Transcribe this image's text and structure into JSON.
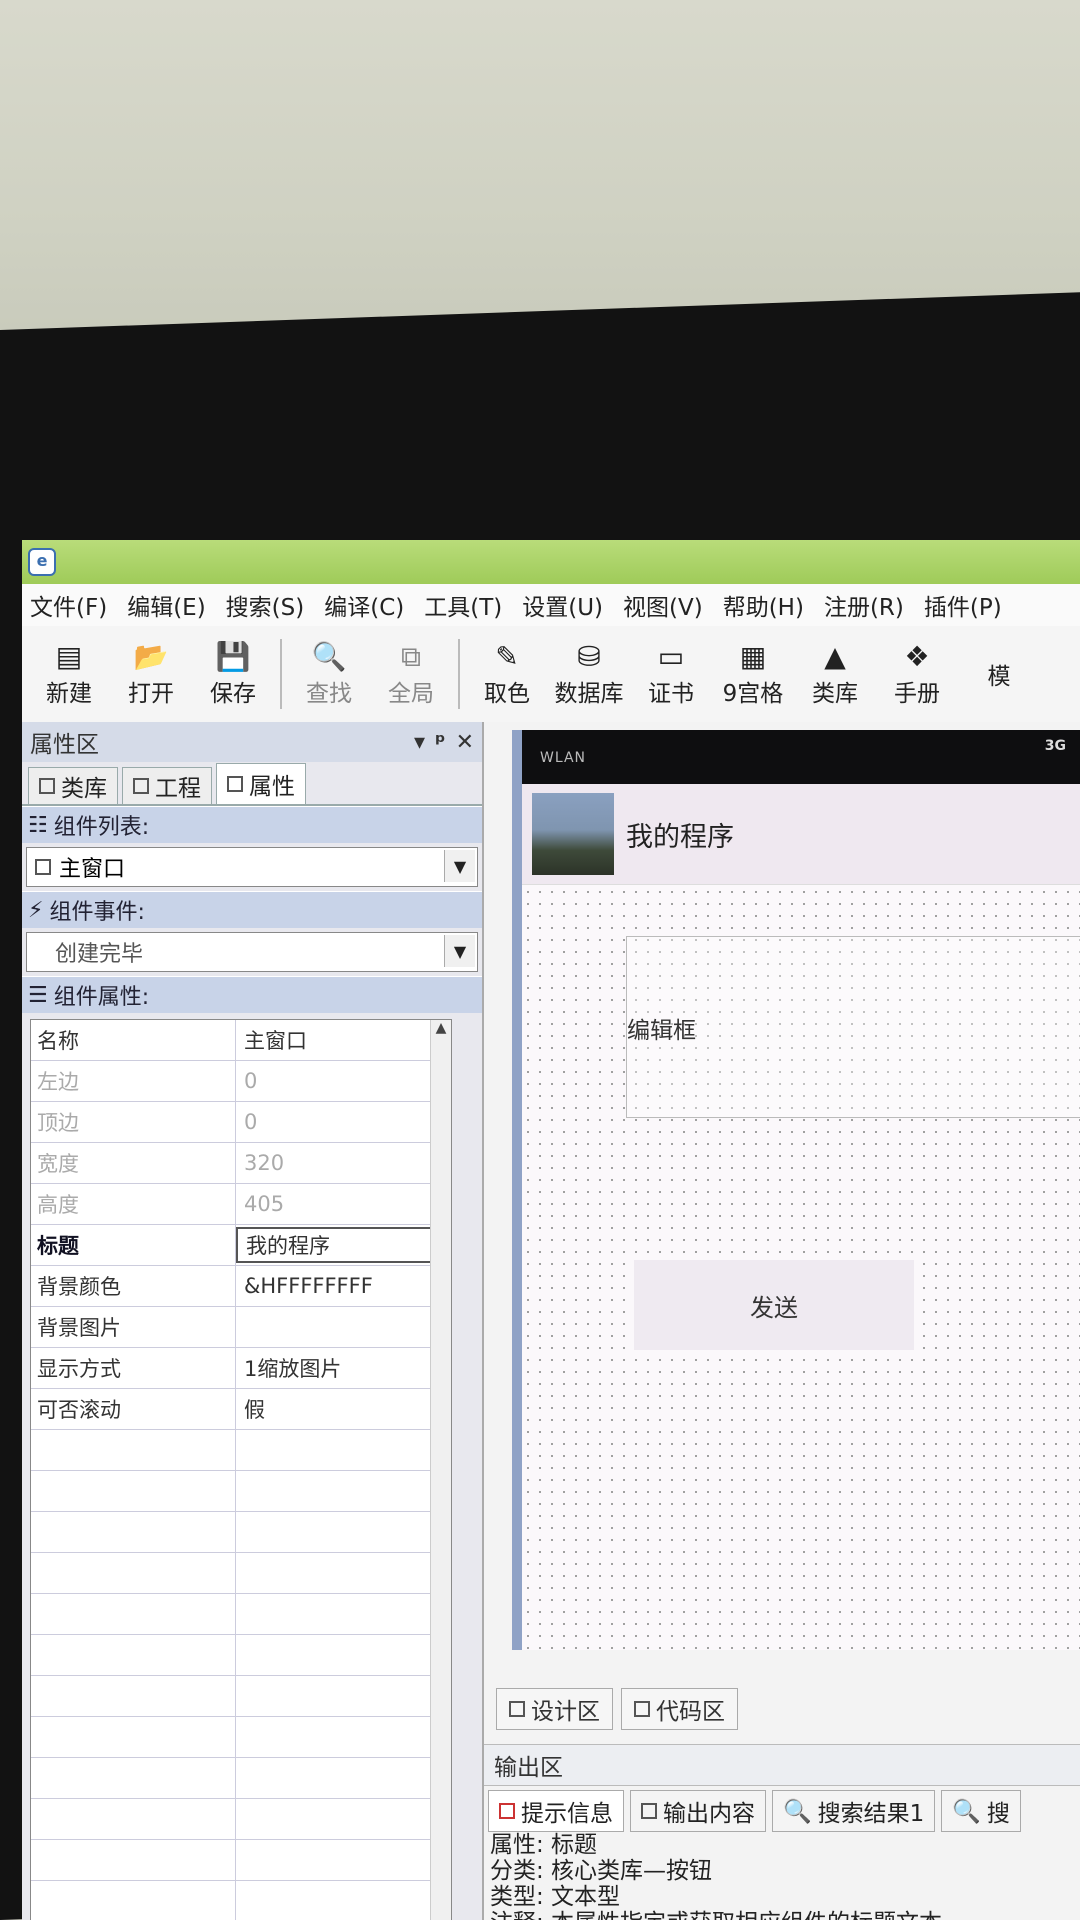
{
  "menu": [
    "文件(F)",
    "编辑(E)",
    "搜索(S)",
    "编译(C)",
    "工具(T)",
    "设置(U)",
    "视图(V)",
    "帮助(H)",
    "注册(R)",
    "插件(P)"
  ],
  "toolbar": {
    "group1": [
      {
        "label": "新建",
        "icon": "new-file-icon",
        "glyph": "▤"
      },
      {
        "label": "打开",
        "icon": "folder-open-icon",
        "glyph": "📂"
      },
      {
        "label": "保存",
        "icon": "save-icon",
        "glyph": "💾"
      }
    ],
    "group2": [
      {
        "label": "查找",
        "icon": "search-icon",
        "glyph": "🔍"
      },
      {
        "label": "全局",
        "icon": "global-search-icon",
        "glyph": "⧉"
      }
    ],
    "group3": [
      {
        "label": "取色",
        "icon": "eyedropper-icon",
        "glyph": "✎"
      },
      {
        "label": "数据库",
        "icon": "database-icon",
        "glyph": "⛁"
      },
      {
        "label": "证书",
        "icon": "certificate-icon",
        "glyph": "▭"
      },
      {
        "label": "9宫格",
        "icon": "grid-icon",
        "glyph": "▦"
      },
      {
        "label": "类库",
        "icon": "library-icon",
        "glyph": "▲"
      },
      {
        "label": "手册",
        "icon": "manual-icon",
        "glyph": "❖"
      },
      {
        "label": "模",
        "icon": "template-icon",
        "glyph": ""
      }
    ]
  },
  "panel": {
    "title": "属性区",
    "controls": [
      "▾",
      "ᵠ",
      "✕"
    ],
    "tabs": [
      "类库",
      "工程",
      "属性"
    ],
    "component_list_label": "组件列表:",
    "component_list_value": "主窗口",
    "component_event_label": "组件事件:",
    "component_event_value": "创建完毕",
    "component_props_label": "组件属性:",
    "properties": [
      {
        "k": "名称",
        "v": "主窗口",
        "state": "normal"
      },
      {
        "k": "左边",
        "v": "0",
        "state": "dim"
      },
      {
        "k": "顶边",
        "v": "0",
        "state": "dim"
      },
      {
        "k": "宽度",
        "v": "320",
        "state": "dim"
      },
      {
        "k": "高度",
        "v": "405",
        "state": "dim"
      },
      {
        "k": "标题",
        "v": "我的程序",
        "state": "bold"
      },
      {
        "k": "背景颜色",
        "v": "&HFFFFFFFF",
        "state": "normal"
      },
      {
        "k": "背景图片",
        "v": "",
        "state": "normal"
      },
      {
        "k": "显示方式",
        "v": "1缩放图片",
        "state": "normal"
      },
      {
        "k": "可否滚动",
        "v": "假",
        "state": "normal"
      }
    ]
  },
  "designer": {
    "status_left": "WLAN",
    "status_right": "3G",
    "app_title": "我的程序",
    "edit_label": "编辑框",
    "send_button": "发送",
    "tabs": [
      "设计区",
      "代码区"
    ]
  },
  "output": {
    "title": "输出区",
    "tabs": [
      "提示信息",
      "输出内容",
      "搜索结果1",
      "搜"
    ],
    "lines": [
      "属性: 标题",
      "分类: 核心类库—按钮",
      "类型: 文本型",
      "注释: 本属性指定或获取相应组件的标题文本。"
    ]
  },
  "colors": {
    "titlebar": "#a7cf62",
    "section": "#c8d3e8",
    "designer_border": "#8fa2c6"
  }
}
